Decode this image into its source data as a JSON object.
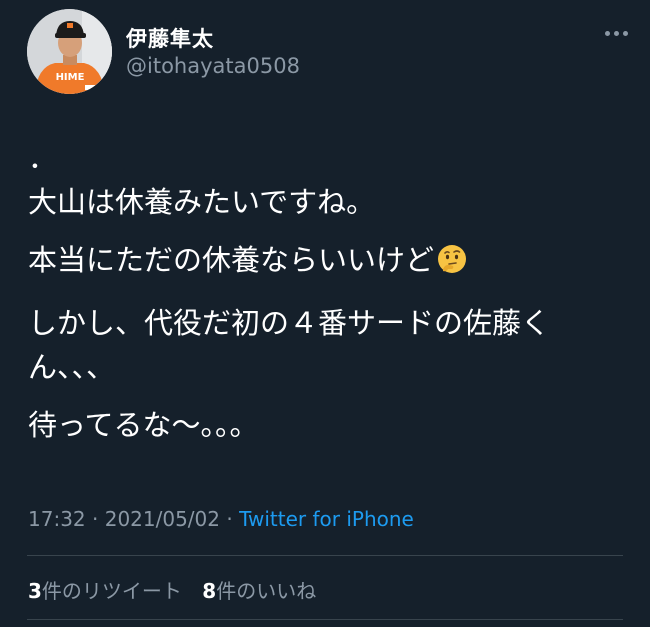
{
  "author": {
    "display_name": "伊藤隼太",
    "handle": "@itohayata0508",
    "avatar_jersey_text": "HIME"
  },
  "tweet": {
    "lines": [
      "．",
      "大山は休養みたいですね。",
      "本当にただの休養ならいいけど",
      "しかし、代役だ初の４番サードの佐藤くん、、、",
      "待ってるな〜。。。"
    ],
    "emoji": "thinking-face"
  },
  "meta": {
    "time": "17:32",
    "separator": "·",
    "date": "2021/05/02",
    "source": "Twitter for iPhone"
  },
  "stats": {
    "retweets_count": "3",
    "retweets_label": "件のリツイート",
    "likes_count": "8",
    "likes_label": "件のいいね"
  },
  "colors": {
    "background": "#15202b",
    "primary_text": "#ffffff",
    "secondary_text": "#8b98a5",
    "link": "#1d9bf0",
    "divider": "#38444d"
  }
}
